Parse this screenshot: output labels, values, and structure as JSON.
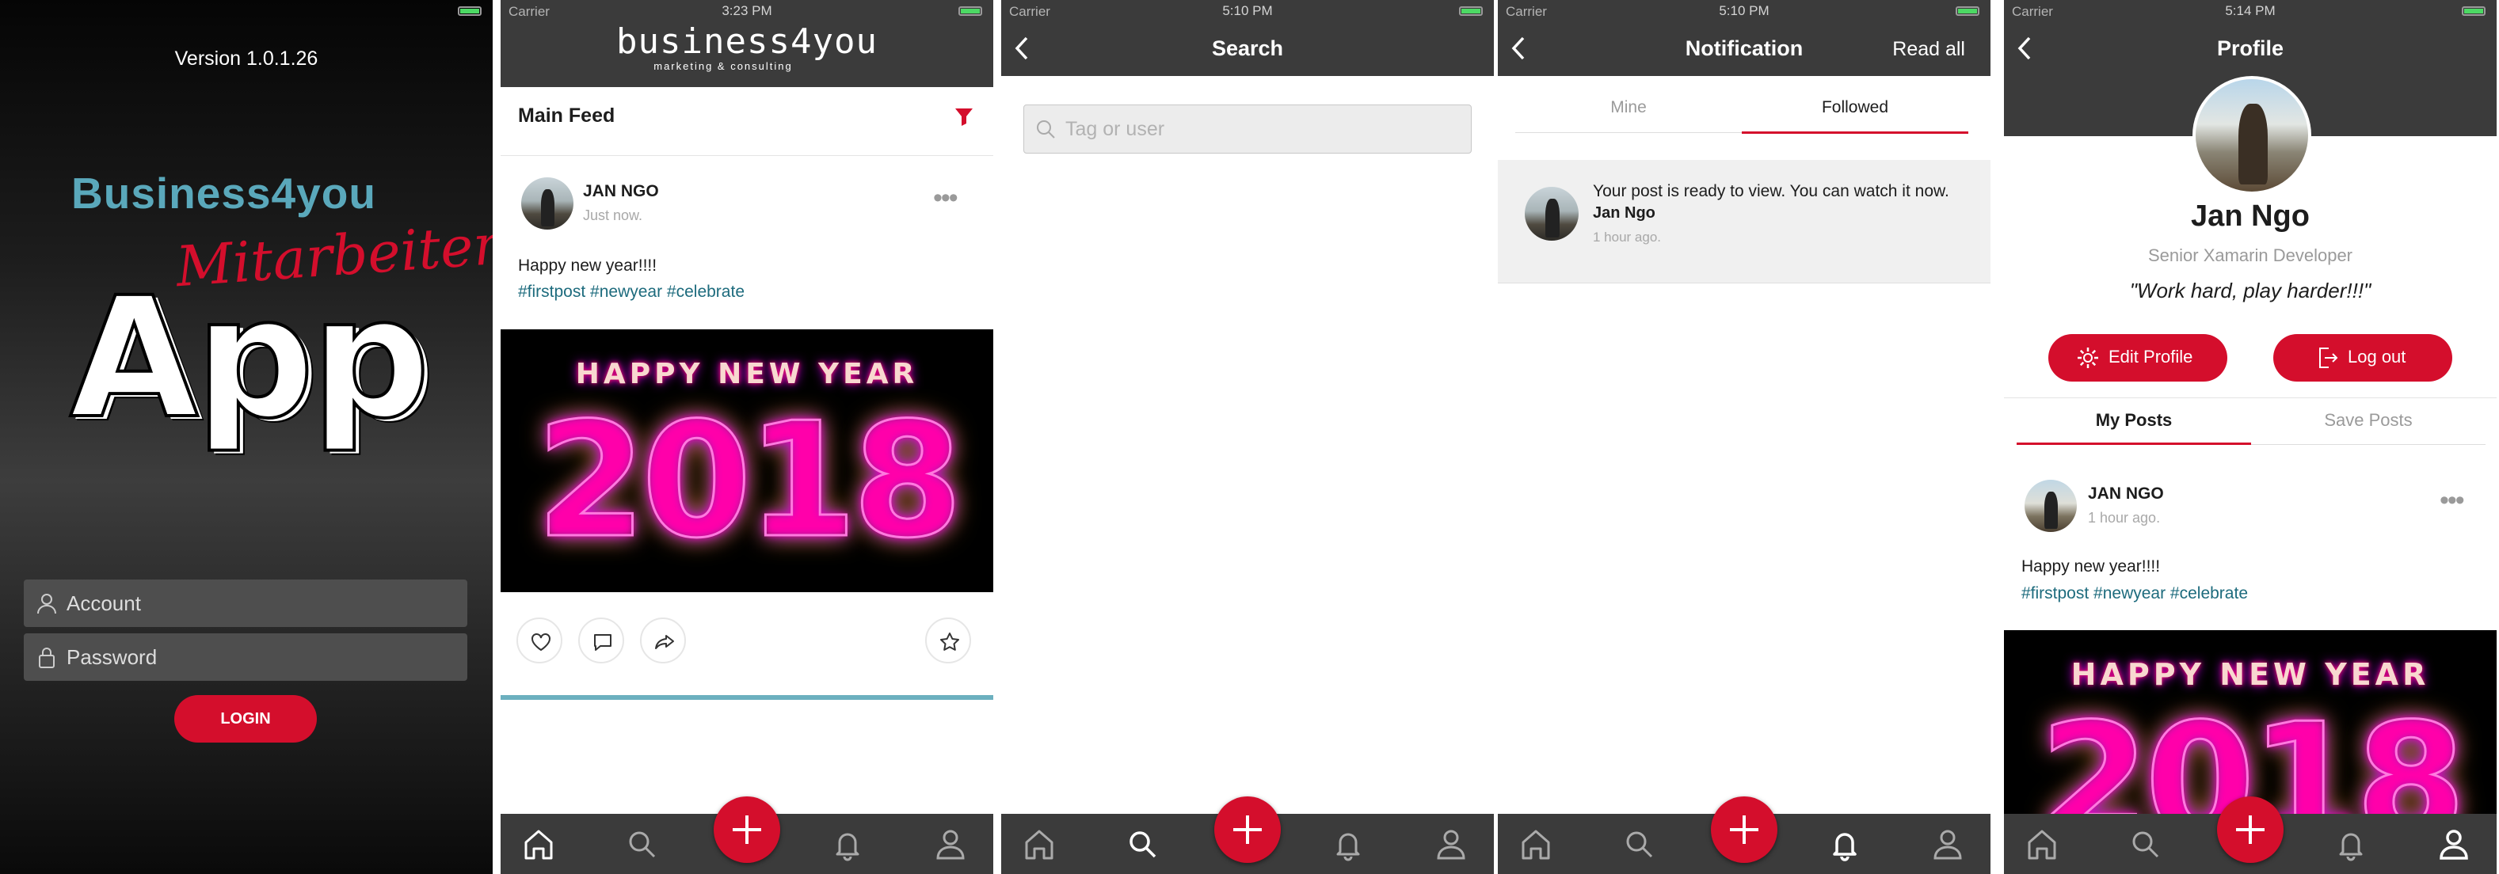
{
  "login": {
    "version": "Version 1.0.1.26",
    "brand": "Business4you",
    "subbrand": "Mitarbeiter",
    "app": "App",
    "account_placeholder": "Account",
    "password_placeholder": "Password",
    "login_label": "LOGIN"
  },
  "status": {
    "carrier": "Carrier"
  },
  "feed": {
    "time": "3:23 PM",
    "logo_main": "business4you",
    "logo_sub": "marketing & consulting",
    "title": "Main Feed",
    "post": {
      "author": "JAN NGO",
      "time": "Just now.",
      "text": "Happy new year!!!!",
      "hashtags": "#firstpost #newyear #celebrate",
      "image_line1": "HAPPY NEW YEAR",
      "image_line2": "2018"
    }
  },
  "search": {
    "time": "5:10 PM",
    "title": "Search",
    "placeholder": "Tag or user"
  },
  "notification": {
    "time": "5:10 PM",
    "title": "Notification",
    "read_all": "Read all",
    "tabs": [
      "Mine",
      "Followed"
    ],
    "item": {
      "text": "Your post is ready to view. You can watch it now.",
      "author": "Jan Ngo",
      "time": "1 hour ago."
    }
  },
  "profile": {
    "time": "5:14 PM",
    "title": "Profile",
    "name": "Jan Ngo",
    "role": "Senior Xamarin Developer",
    "quote": "\"Work hard, play harder!!!\"",
    "edit_label": "Edit Profile",
    "logout_label": "Log out",
    "tabs": [
      "My Posts",
      "Save Posts"
    ],
    "post": {
      "author": "JAN NGO",
      "time": "1 hour ago.",
      "text": "Happy new year!!!!",
      "hashtags": "#firstpost #newyear #celebrate",
      "image_line1": "HAPPY NEW YEAR",
      "image_line2": "2018"
    }
  },
  "colors": {
    "accent": "#d40e2c",
    "bar": "#3b3b3b",
    "brand_blue": "#5aa8bb",
    "hashtag": "#1d6b7d"
  }
}
